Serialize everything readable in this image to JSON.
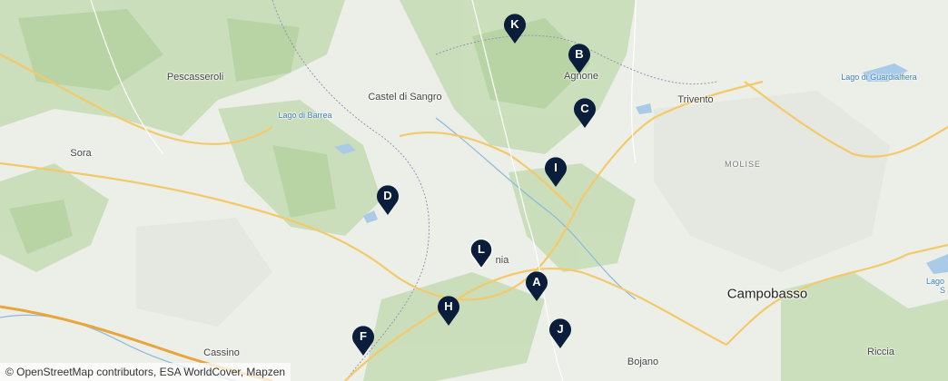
{
  "map": {
    "places": [
      {
        "id": "pescasseroli",
        "label": "Pescasseroli",
        "kind": "town"
      },
      {
        "id": "castel-di-sangro",
        "label": "Castel di Sangro",
        "kind": "town"
      },
      {
        "id": "lago-di-barrea",
        "label": "Lago di Barrea",
        "kind": "lake"
      },
      {
        "id": "sora",
        "label": "Sora",
        "kind": "town"
      },
      {
        "id": "agnone",
        "label": "Agnone",
        "kind": "town"
      },
      {
        "id": "trivento",
        "label": "Trivento",
        "kind": "town"
      },
      {
        "id": "lago-di-guardialfiera",
        "label": "Lago di Guardialfiera",
        "kind": "lake"
      },
      {
        "id": "molise",
        "label": "MOLISE",
        "kind": "region"
      },
      {
        "id": "campobasso",
        "label": "Campobasso",
        "kind": "city"
      },
      {
        "id": "cassino",
        "label": "Cassino",
        "kind": "town"
      },
      {
        "id": "bojano",
        "label": "Bojano",
        "kind": "town"
      },
      {
        "id": "riccia",
        "label": "Riccia",
        "kind": "town"
      },
      {
        "id": "isernia-partial",
        "label": "nia",
        "kind": "town"
      },
      {
        "id": "lago-partial",
        "label": "Lago",
        "kind": "lake"
      },
      {
        "id": "lago-partial-2",
        "label": "S",
        "kind": "lake"
      }
    ],
    "markers": [
      "A",
      "B",
      "C",
      "D",
      "F",
      "H",
      "I",
      "J",
      "K",
      "L"
    ],
    "attribution": "© OpenStreetMap contributors, ESA WorldCover, Mapzen",
    "colors": {
      "marker": "#0a1e3c",
      "water": "#a9cbe8",
      "forest": "#b9d6a8",
      "road": "#f3c96a"
    }
  }
}
